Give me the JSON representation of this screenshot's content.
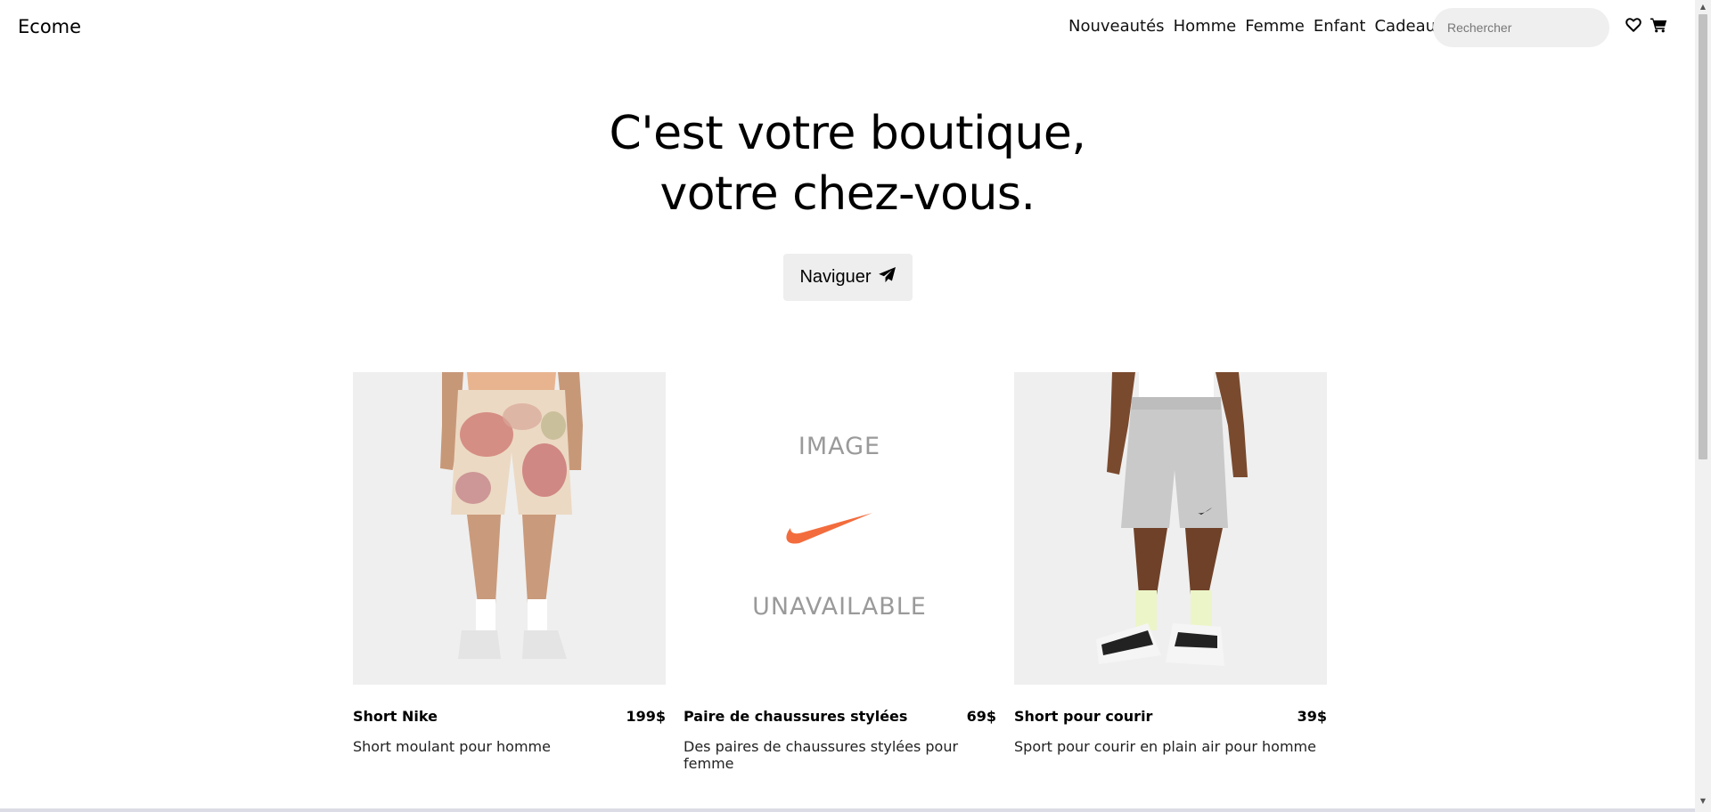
{
  "header": {
    "logo": "Ecome",
    "nav": [
      "Nouveautés",
      "Homme",
      "Femme",
      "Enfant",
      "Cadeaux"
    ],
    "search_placeholder": "Rechercher",
    "icons": [
      "heart-icon",
      "cart-icon"
    ]
  },
  "hero": {
    "line1": "C'est votre boutique,",
    "line2": "votre chez-vous.",
    "cta_label": "Naviguer"
  },
  "products": [
    {
      "name": "Short Nike",
      "price": "199$",
      "description": "Short moulant pour homme",
      "image": "tie-dye-shorts"
    },
    {
      "name": "Paire de chaussures stylées",
      "price": "69$",
      "description": "Des paires de chaussures stylées pour femme",
      "image": "unavailable",
      "placeholder_top": "IMAGE",
      "placeholder_bottom": "UNAVAILABLE"
    },
    {
      "name": "Short pour courir",
      "price": "39$",
      "description": "Sport pour courir en plain air pour homme",
      "image": "grey-shorts"
    }
  ],
  "colors": {
    "swoosh": "#f36c3d",
    "search_bg": "#efefef",
    "cta_bg": "#eeeeee"
  }
}
